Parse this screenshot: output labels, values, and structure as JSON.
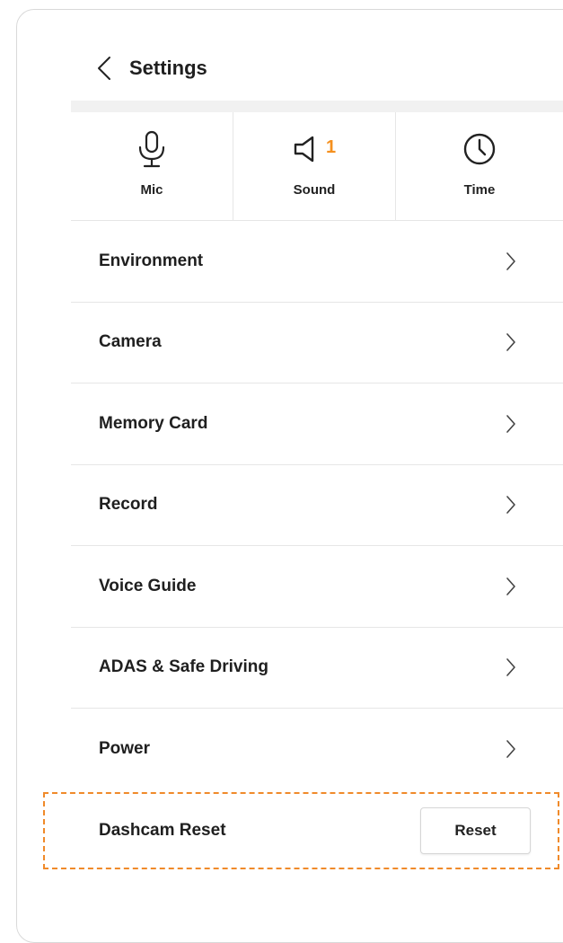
{
  "header": {
    "title": "Settings",
    "back_icon": "chevron-left-icon"
  },
  "quick_settings": [
    {
      "label": "Mic",
      "icon": "microphone-icon"
    },
    {
      "label": "Sound",
      "icon": "speaker-icon",
      "badge": "1"
    },
    {
      "label": "Time",
      "icon": "clock-icon"
    }
  ],
  "menu": {
    "items": [
      {
        "label": "Environment"
      },
      {
        "label": "Camera"
      },
      {
        "label": "Memory Card"
      },
      {
        "label": "Record"
      },
      {
        "label": "Voice Guide"
      },
      {
        "label": "ADAS & Safe Driving"
      },
      {
        "label": "Power"
      }
    ],
    "chevron_icon": "chevron-right-icon"
  },
  "reset": {
    "label": "Dashcam Reset",
    "button_label": "Reset"
  },
  "colors": {
    "accent": "#f5901e",
    "highlight_border": "#f08a2a",
    "divider": "#e6e6e6",
    "band": "#f1f1f1"
  }
}
